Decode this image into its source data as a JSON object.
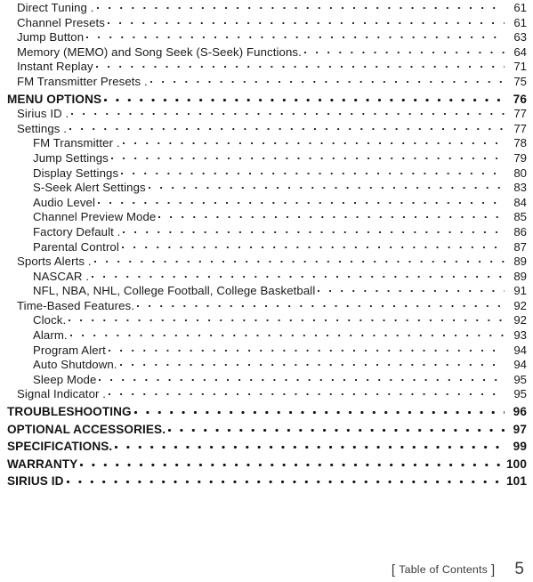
{
  "document": {
    "type": "table-of-contents",
    "page_number": "5",
    "footer_label": "Table of Contents",
    "footer_bracket_left": "[",
    "footer_bracket_right": "]"
  },
  "entries": [
    {
      "title": "Direct Tuning .",
      "page": "61",
      "level": 1,
      "bold": false
    },
    {
      "title": "Channel Presets",
      "page": "61",
      "level": 1,
      "bold": false
    },
    {
      "title": "Jump Button",
      "page": "63",
      "level": 1,
      "bold": false
    },
    {
      "title": "Memory (MEMO) and Song Seek (S-Seek) Functions.",
      "page": "64",
      "level": 1,
      "bold": false
    },
    {
      "title": "Instant Replay",
      "page": "71",
      "level": 1,
      "bold": false
    },
    {
      "title": "FM Transmitter Presets .",
      "page": "75",
      "level": 1,
      "bold": false
    },
    {
      "title": "MENU OPTIONS",
      "page": "76",
      "level": 0,
      "bold": true
    },
    {
      "title": "Sirius ID .",
      "page": "77",
      "level": 1,
      "bold": false
    },
    {
      "title": "Settings .",
      "page": "77",
      "level": 1,
      "bold": false
    },
    {
      "title": "FM Transmitter .",
      "page": "78",
      "level": 2,
      "bold": false
    },
    {
      "title": "Jump Settings",
      "page": "79",
      "level": 2,
      "bold": false
    },
    {
      "title": "Display Settings",
      "page": "80",
      "level": 2,
      "bold": false
    },
    {
      "title": "S-Seek Alert Settings",
      "page": "83",
      "level": 2,
      "bold": false
    },
    {
      "title": "Audio Level",
      "page": "84",
      "level": 2,
      "bold": false
    },
    {
      "title": "Channel Preview Mode",
      "page": "85",
      "level": 2,
      "bold": false
    },
    {
      "title": "Factory Default .",
      "page": "86",
      "level": 2,
      "bold": false
    },
    {
      "title": "Parental Control",
      "page": "87",
      "level": 2,
      "bold": false
    },
    {
      "title": "Sports Alerts .",
      "page": "89",
      "level": 1,
      "bold": false
    },
    {
      "title": "NASCAR .",
      "page": "89",
      "level": 2,
      "bold": false
    },
    {
      "title": "NFL, NBA, NHL, College Football, College Basketball",
      "page": "91",
      "level": 2,
      "bold": false
    },
    {
      "title": "Time-Based Features.",
      "page": "92",
      "level": 1,
      "bold": false
    },
    {
      "title": "Clock.",
      "page": "92",
      "level": 2,
      "bold": false
    },
    {
      "title": "Alarm.",
      "page": "93",
      "level": 2,
      "bold": false
    },
    {
      "title": "Program Alert",
      "page": "94",
      "level": 2,
      "bold": false
    },
    {
      "title": "Auto Shutdown.",
      "page": "94",
      "level": 2,
      "bold": false
    },
    {
      "title": "Sleep Mode",
      "page": "95",
      "level": 2,
      "bold": false
    },
    {
      "title": "Signal Indicator .",
      "page": "95",
      "level": 1,
      "bold": false
    },
    {
      "title": "TROUBLESHOOTING",
      "page": "96",
      "level": 0,
      "bold": true
    },
    {
      "title": "OPTIONAL ACCESSORIES.",
      "page": "97",
      "level": 0,
      "bold": true
    },
    {
      "title": "SPECIFICATIONS.",
      "page": "99",
      "level": 0,
      "bold": true
    },
    {
      "title": "WARRANTY",
      "page": "100",
      "level": 0,
      "bold": true
    },
    {
      "title": "SIRIUS ID",
      "page": "101",
      "level": 0,
      "bold": true
    }
  ]
}
